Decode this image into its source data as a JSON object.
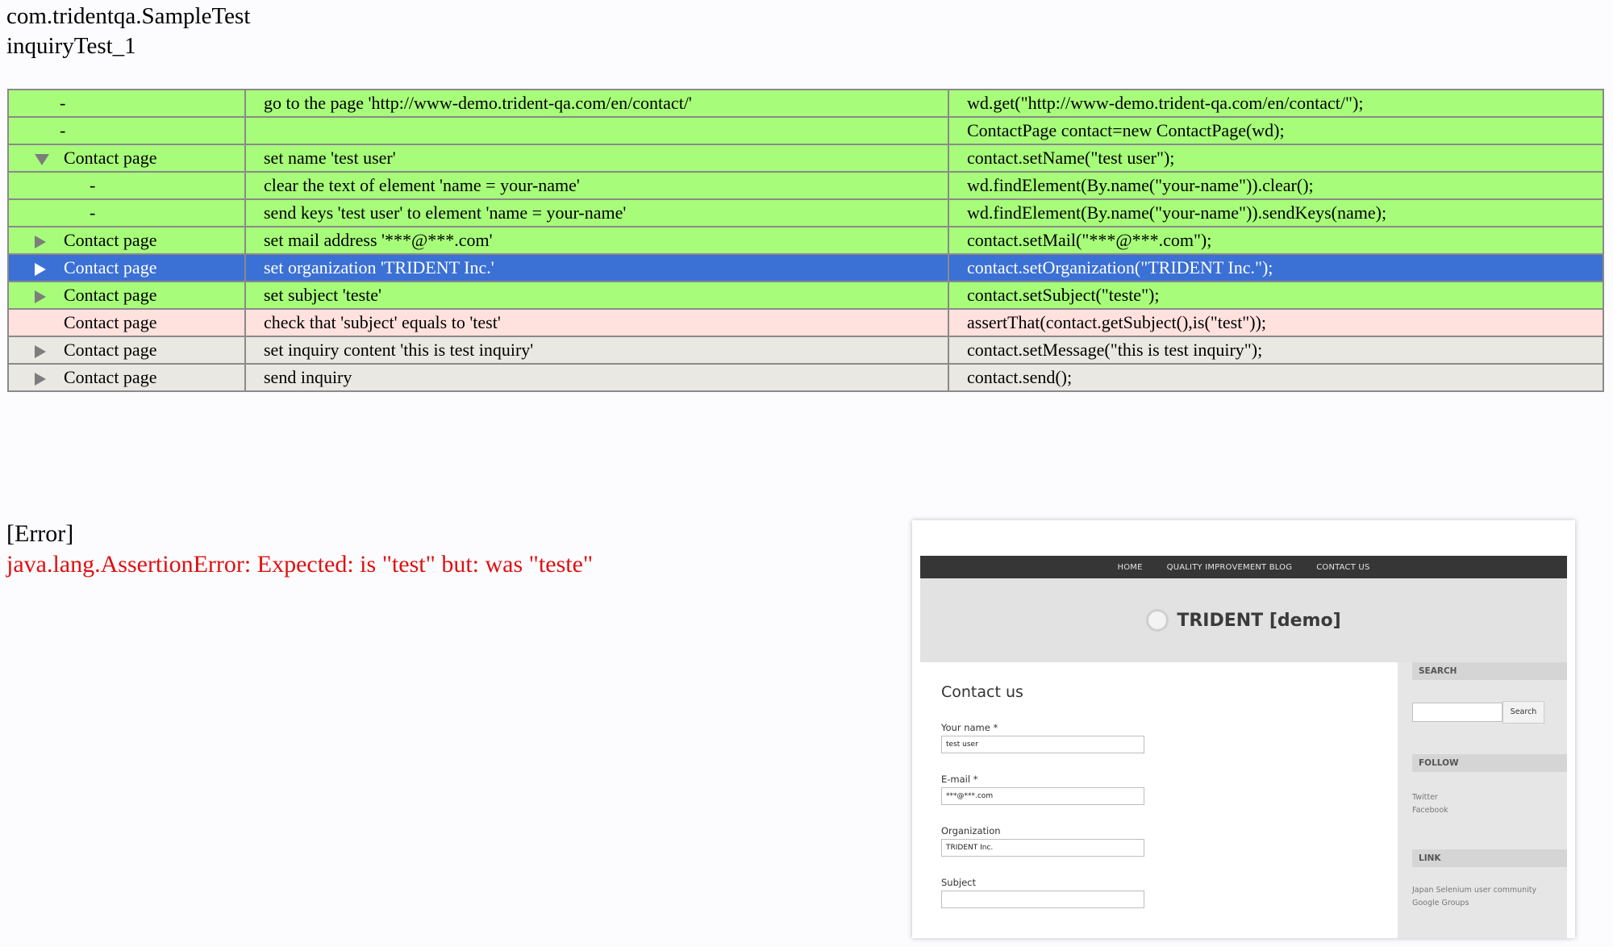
{
  "header": {
    "class_name": "com.tridentqa.SampleTest",
    "method_name": "inquiryTest_1"
  },
  "steps": [
    {
      "status": "pass",
      "marker": "dash",
      "indent": 1,
      "page": "-",
      "action": "go to the page 'http://www-demo.trident-qa.com/en/contact/'",
      "code": "wd.get(\"http://www-demo.trident-qa.com/en/contact/\");"
    },
    {
      "status": "pass",
      "marker": "dash",
      "indent": 1,
      "page": "-",
      "action": "",
      "code": "ContactPage contact=new ContactPage(wd);"
    },
    {
      "status": "pass",
      "marker": "expanded",
      "indent": 1,
      "page": "Contact page",
      "action": "set name 'test user'",
      "code": "contact.setName(\"test user\");"
    },
    {
      "status": "pass",
      "marker": "dash",
      "indent": 2,
      "page": "-",
      "action": "clear the text of element 'name = your-name'",
      "code": "wd.findElement(By.name(\"your-name\")).clear();"
    },
    {
      "status": "pass",
      "marker": "dash",
      "indent": 2,
      "page": "-",
      "action": "send keys 'test user' to element 'name = your-name'",
      "code": "wd.findElement(By.name(\"your-name\")).sendKeys(name);"
    },
    {
      "status": "pass",
      "marker": "collapsed",
      "indent": 1,
      "page": "Contact page",
      "action": "set mail address '***@***.com'",
      "code": "contact.setMail(\"***@***.com\");"
    },
    {
      "status": "selected",
      "marker": "collapsed",
      "indent": 1,
      "page": "Contact page",
      "action": "set organization 'TRIDENT Inc.'",
      "code": "contact.setOrganization(\"TRIDENT Inc.\");"
    },
    {
      "status": "pass",
      "marker": "collapsed",
      "indent": 1,
      "page": "Contact page",
      "action": "set subject 'teste'",
      "code": "contact.setSubject(\"teste\");"
    },
    {
      "status": "fail",
      "marker": "none",
      "indent": 1,
      "page": "Contact page",
      "action": "check that 'subject' equals to 'test'",
      "code": "assertThat(contact.getSubject(),is(\"test\"));"
    },
    {
      "status": "none",
      "marker": "collapsed",
      "indent": 1,
      "page": "Contact page",
      "action": "set inquiry content 'this is test inquiry'",
      "code": "contact.setMessage(\"this is test inquiry\");"
    },
    {
      "status": "none",
      "marker": "collapsed",
      "indent": 1,
      "page": "Contact page",
      "action": "send inquiry",
      "code": "contact.send();"
    }
  ],
  "error": {
    "title": "[Error]",
    "message": "java.lang.AssertionError: Expected: is \"test\" but: was \"teste\""
  },
  "screenshot": {
    "nav": [
      "HOME",
      "QUALITY IMPROVEMENT BLOG",
      "CONTACT US"
    ],
    "site_title": "TRIDENT [demo]",
    "contact_title": "Contact us",
    "fields": [
      {
        "label": "Your name *",
        "value": "test user"
      },
      {
        "label": "E-mail *",
        "value": "***@***.com"
      },
      {
        "label": "Organization",
        "value": "TRIDENT Inc."
      },
      {
        "label": "Subject",
        "value": ""
      }
    ],
    "sidebar": {
      "search_heading": "SEARCH",
      "search_button": "Search",
      "follow_heading": "FOLLOW",
      "follow_links": [
        "Twitter",
        "Facebook"
      ],
      "link_heading": "LINK",
      "link_text": "Japan Selenium user community Google Groups"
    }
  },
  "colors": {
    "pass": "#a7fd79",
    "fail": "#ffe1dd",
    "not_run": "#e9e8e2",
    "selected": "#3b70d5",
    "error_text": "#e01010"
  }
}
